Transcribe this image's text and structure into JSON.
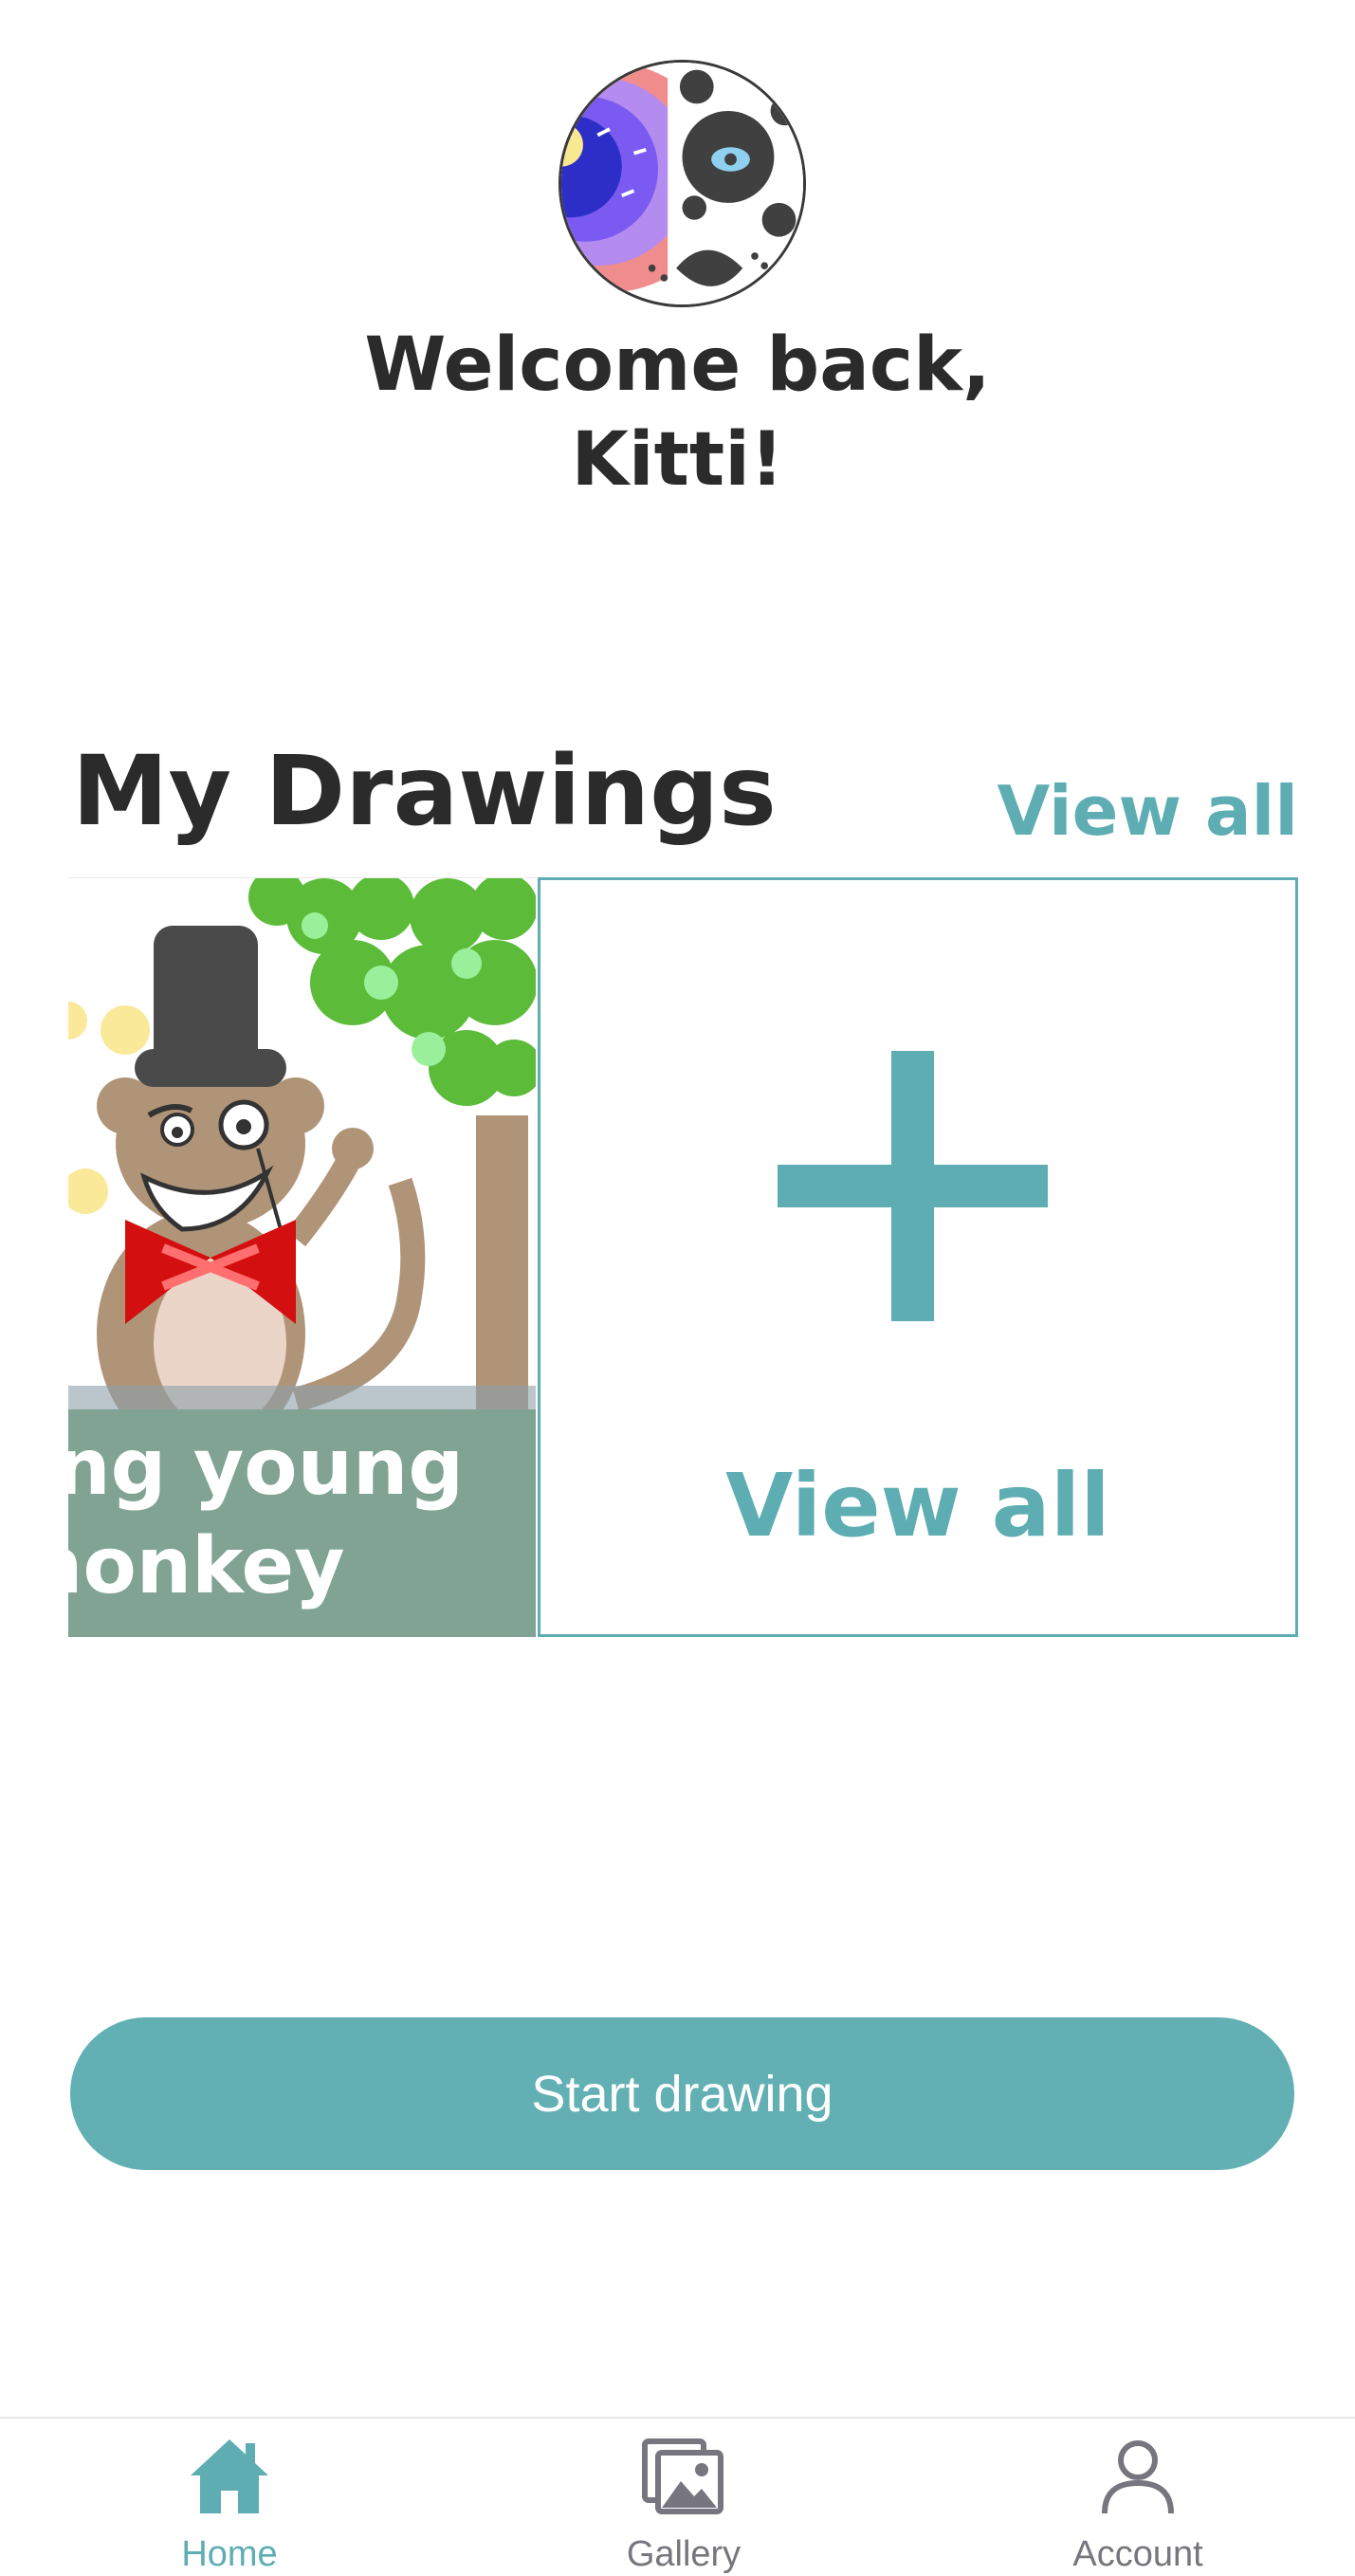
{
  "header": {
    "welcome_line1": "Welcome back,",
    "welcome_line2": "Kitti!"
  },
  "drawings": {
    "title": "My Drawings",
    "view_all_link": "View all",
    "cards": [
      {
        "caption": "ling young\nmonkey"
      }
    ],
    "view_all_card_label": "View all"
  },
  "actions": {
    "start_drawing": "Start drawing"
  },
  "nav": {
    "items": [
      {
        "label": "Home",
        "icon": "home-icon",
        "active": true
      },
      {
        "label": "Gallery",
        "icon": "gallery-icon",
        "active": false
      },
      {
        "label": "Account",
        "icon": "account-icon",
        "active": false
      }
    ]
  },
  "colors": {
    "accent": "#5eadb3",
    "button": "#62b0b4",
    "text": "#2b2b2b",
    "nav_inactive": "#77757d"
  }
}
